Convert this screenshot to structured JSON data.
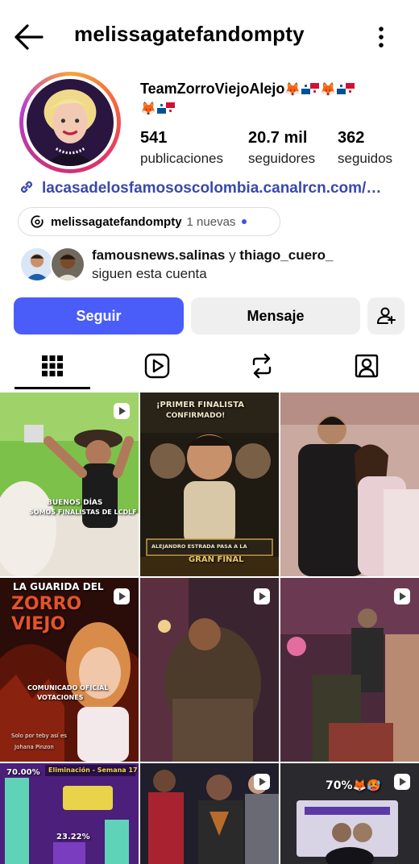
{
  "header": {
    "username": "melissagatefandompty"
  },
  "profile": {
    "bio_name": "TeamZorroViejoAlejo",
    "stats": [
      {
        "value": "541",
        "label": "publicaciones"
      },
      {
        "value": "20.7 mil",
        "label": "seguidores"
      },
      {
        "value": "362",
        "label": "seguidos"
      }
    ],
    "link_text": "lacasadelosfamososcolombia.canalrcn.com/…",
    "threads": {
      "user": "melissagatefandompty",
      "new_label": "1 nuevas"
    },
    "followed_by": {
      "names": "famousnews.salinas",
      "connector": " y ",
      "names2": "thiago_cuero_",
      "suffix": "siguen esta cuenta"
    }
  },
  "actions": {
    "follow_label": "Seguir",
    "message_label": "Mensaje"
  },
  "tabs": [
    {
      "icon": "grid-icon"
    },
    {
      "icon": "reels-icon"
    },
    {
      "icon": "reposts-icon"
    },
    {
      "icon": "tagged-icon"
    }
  ],
  "grid": {
    "captions": {
      "c1a": "BUENOS DÍAS",
      "c1b": "SOMOS FINALISTAS DE LCDLF",
      "c2a": "¡PRIMER FINALISTA",
      "c2b": "CONFIRMADO!",
      "c2c": "ALEJANDRO ESTRADA PASA A LA",
      "c2d": "GRAN FINAL",
      "c4a": "LA GUARIDA DEL",
      "c4b": "ZORRO VIEJO",
      "c4c": "COMUNICADO OFICIAL",
      "c4d": "VOTACIONES",
      "c4e": "Solo por teby así es",
      "c4f": "Johana Pinzon",
      "c7a": "70.00%",
      "c7b": "Eliminación - Semana 17",
      "c7c": "23.22%",
      "c9a": "70%"
    }
  },
  "colors": {
    "accent": "#4a5df9",
    "link": "#3949ab",
    "button_secondary": "#efefef"
  }
}
